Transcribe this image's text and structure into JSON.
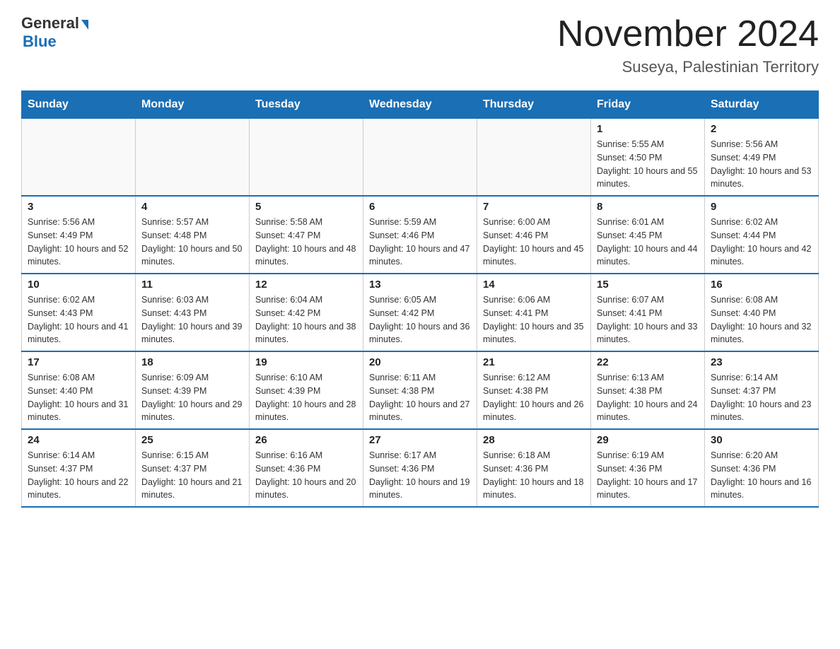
{
  "header": {
    "logo": {
      "general": "General",
      "blue": "Blue"
    },
    "title": "November 2024",
    "subtitle": "Suseya, Palestinian Territory"
  },
  "calendar": {
    "days_of_week": [
      "Sunday",
      "Monday",
      "Tuesday",
      "Wednesday",
      "Thursday",
      "Friday",
      "Saturday"
    ],
    "weeks": [
      [
        {
          "day": "",
          "info": ""
        },
        {
          "day": "",
          "info": ""
        },
        {
          "day": "",
          "info": ""
        },
        {
          "day": "",
          "info": ""
        },
        {
          "day": "",
          "info": ""
        },
        {
          "day": "1",
          "info": "Sunrise: 5:55 AM\nSunset: 4:50 PM\nDaylight: 10 hours and 55 minutes."
        },
        {
          "day": "2",
          "info": "Sunrise: 5:56 AM\nSunset: 4:49 PM\nDaylight: 10 hours and 53 minutes."
        }
      ],
      [
        {
          "day": "3",
          "info": "Sunrise: 5:56 AM\nSunset: 4:49 PM\nDaylight: 10 hours and 52 minutes."
        },
        {
          "day": "4",
          "info": "Sunrise: 5:57 AM\nSunset: 4:48 PM\nDaylight: 10 hours and 50 minutes."
        },
        {
          "day": "5",
          "info": "Sunrise: 5:58 AM\nSunset: 4:47 PM\nDaylight: 10 hours and 48 minutes."
        },
        {
          "day": "6",
          "info": "Sunrise: 5:59 AM\nSunset: 4:46 PM\nDaylight: 10 hours and 47 minutes."
        },
        {
          "day": "7",
          "info": "Sunrise: 6:00 AM\nSunset: 4:46 PM\nDaylight: 10 hours and 45 minutes."
        },
        {
          "day": "8",
          "info": "Sunrise: 6:01 AM\nSunset: 4:45 PM\nDaylight: 10 hours and 44 minutes."
        },
        {
          "day": "9",
          "info": "Sunrise: 6:02 AM\nSunset: 4:44 PM\nDaylight: 10 hours and 42 minutes."
        }
      ],
      [
        {
          "day": "10",
          "info": "Sunrise: 6:02 AM\nSunset: 4:43 PM\nDaylight: 10 hours and 41 minutes."
        },
        {
          "day": "11",
          "info": "Sunrise: 6:03 AM\nSunset: 4:43 PM\nDaylight: 10 hours and 39 minutes."
        },
        {
          "day": "12",
          "info": "Sunrise: 6:04 AM\nSunset: 4:42 PM\nDaylight: 10 hours and 38 minutes."
        },
        {
          "day": "13",
          "info": "Sunrise: 6:05 AM\nSunset: 4:42 PM\nDaylight: 10 hours and 36 minutes."
        },
        {
          "day": "14",
          "info": "Sunrise: 6:06 AM\nSunset: 4:41 PM\nDaylight: 10 hours and 35 minutes."
        },
        {
          "day": "15",
          "info": "Sunrise: 6:07 AM\nSunset: 4:41 PM\nDaylight: 10 hours and 33 minutes."
        },
        {
          "day": "16",
          "info": "Sunrise: 6:08 AM\nSunset: 4:40 PM\nDaylight: 10 hours and 32 minutes."
        }
      ],
      [
        {
          "day": "17",
          "info": "Sunrise: 6:08 AM\nSunset: 4:40 PM\nDaylight: 10 hours and 31 minutes."
        },
        {
          "day": "18",
          "info": "Sunrise: 6:09 AM\nSunset: 4:39 PM\nDaylight: 10 hours and 29 minutes."
        },
        {
          "day": "19",
          "info": "Sunrise: 6:10 AM\nSunset: 4:39 PM\nDaylight: 10 hours and 28 minutes."
        },
        {
          "day": "20",
          "info": "Sunrise: 6:11 AM\nSunset: 4:38 PM\nDaylight: 10 hours and 27 minutes."
        },
        {
          "day": "21",
          "info": "Sunrise: 6:12 AM\nSunset: 4:38 PM\nDaylight: 10 hours and 26 minutes."
        },
        {
          "day": "22",
          "info": "Sunrise: 6:13 AM\nSunset: 4:38 PM\nDaylight: 10 hours and 24 minutes."
        },
        {
          "day": "23",
          "info": "Sunrise: 6:14 AM\nSunset: 4:37 PM\nDaylight: 10 hours and 23 minutes."
        }
      ],
      [
        {
          "day": "24",
          "info": "Sunrise: 6:14 AM\nSunset: 4:37 PM\nDaylight: 10 hours and 22 minutes."
        },
        {
          "day": "25",
          "info": "Sunrise: 6:15 AM\nSunset: 4:37 PM\nDaylight: 10 hours and 21 minutes."
        },
        {
          "day": "26",
          "info": "Sunrise: 6:16 AM\nSunset: 4:36 PM\nDaylight: 10 hours and 20 minutes."
        },
        {
          "day": "27",
          "info": "Sunrise: 6:17 AM\nSunset: 4:36 PM\nDaylight: 10 hours and 19 minutes."
        },
        {
          "day": "28",
          "info": "Sunrise: 6:18 AM\nSunset: 4:36 PM\nDaylight: 10 hours and 18 minutes."
        },
        {
          "day": "29",
          "info": "Sunrise: 6:19 AM\nSunset: 4:36 PM\nDaylight: 10 hours and 17 minutes."
        },
        {
          "day": "30",
          "info": "Sunrise: 6:20 AM\nSunset: 4:36 PM\nDaylight: 10 hours and 16 minutes."
        }
      ]
    ]
  }
}
